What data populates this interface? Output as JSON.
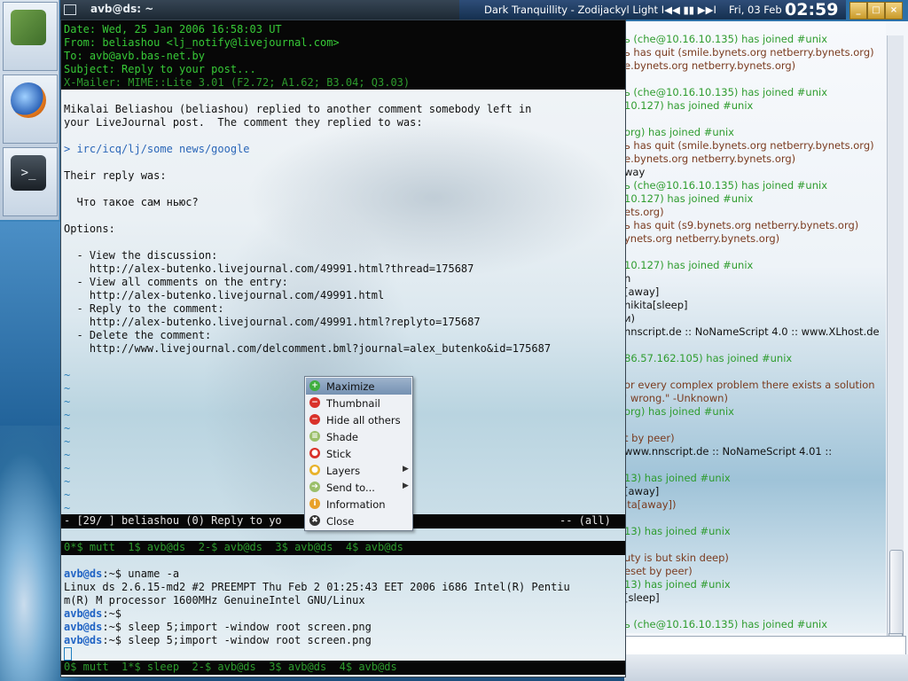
{
  "terminal": {
    "title": "avb@ds: ~",
    "headers": [
      "Date: Wed, 25 Jan 2006 16:58:03 UT",
      "From: beliashou <lj_notify@livejournal.com>",
      "To: avb@avb.bas-net.by",
      "Subject: Reply to your post...",
      "X-Mailer: MIME::Lite 3.01 (F2.72; A1.62; B3.04; Q3.03)"
    ],
    "body": [
      "Mikalai Beliashou (beliashou) replied to another comment somebody left in",
      "your LiveJournal post.  The comment they replied to was:",
      "",
      "> irc/icq/lj/some news/google",
      "",
      "Their reply was:",
      "",
      "  Что такое сам ньюс?",
      "",
      "Options:",
      "",
      "  - View the discussion:",
      "    http://alex-butenko.livejournal.com/49991.html?thread=175687",
      "  - View all comments on the entry:",
      "    http://alex-butenko.livejournal.com/49991.html",
      "  - Reply to the comment:",
      "    http://alex-butenko.livejournal.com/49991.html?replyto=175687",
      "  - Delete the comment:",
      "    http://www.livejournal.com/delcomment.bml?journal=alex_butenko&id=175687"
    ],
    "tildes": [
      "~",
      "~",
      "~",
      "~",
      "~",
      "~",
      "~",
      "~",
      "~",
      "~",
      "~"
    ],
    "status_left": "- [29/ ] beliashou (0) Reply to yo",
    "status_right": "-- (all)",
    "window_list_1": "0*$ mutt  1$ avb@ds  2-$ avb@ds  3$ avb@ds  4$ avb@ds",
    "shell": [
      {
        "prompt": "avb@ds",
        "path": ":~$",
        "cmd": " uname -a"
      },
      {
        "out": "Linux ds 2.6.15-md2 #2 PREEMPT Thu Feb 2 01:25:43 EET 2006 i686 Intel(R) Pentiu"
      },
      {
        "out": "m(R) M processor 1600MHz GenuineIntel GNU/Linux"
      },
      {
        "prompt": "avb@ds",
        "path": ":~$",
        "cmd": ""
      },
      {
        "prompt": "avb@ds",
        "path": ":~$",
        "cmd": " sleep 5;import -window root screen.png"
      },
      {
        "prompt": "avb@ds",
        "path": ":~$",
        "cmd": " sleep 5;import -window root screen.png"
      }
    ],
    "window_list_2": "0$ mutt  1*$ sleep  2-$ avb@ds  3$ avb@ds  4$ avb@ds"
  },
  "panel": {
    "song": "Dark Tranquillity - Zodijackyl Light",
    "player_controls": "I◀◀ ▮▮ ▶▶I",
    "date": "Fri, 03 Feb",
    "time": "02:59",
    "wm_buttons": [
      "_",
      "□",
      "×"
    ]
  },
  "context_menu": {
    "items": [
      {
        "label": "Maximize",
        "icon": "maximize-icon",
        "color": "#3fae3f",
        "glyph": "+",
        "submenu": false
      },
      {
        "label": "Thumbnail",
        "icon": "thumbnail-icon",
        "color": "#d9312a",
        "glyph": "−",
        "submenu": false
      },
      {
        "label": "Hide all others",
        "icon": "hide-others-icon",
        "color": "#d9312a",
        "glyph": "−",
        "submenu": false
      },
      {
        "label": "Shade",
        "icon": "shade-icon",
        "color": "#9bbf6a",
        "glyph": "≡",
        "submenu": false
      },
      {
        "label": "Stick",
        "icon": "stick-icon",
        "color": "#d9312a",
        "glyph": "●",
        "submenu": false
      },
      {
        "label": "Layers",
        "icon": "layers-icon",
        "color": "#e8b22a",
        "glyph": "●",
        "submenu": true
      },
      {
        "label": "Send to...",
        "icon": "send-to-icon",
        "color": "#9bbf6a",
        "glyph": "➔",
        "submenu": true
      },
      {
        "label": "Information",
        "icon": "information-icon",
        "color": "#e8a12a",
        "glyph": "i",
        "submenu": false
      },
      {
        "label": "Close",
        "icon": "close-icon",
        "color": "#333333",
        "glyph": "✖",
        "submenu": false
      }
    ]
  },
  "irc": {
    "lines": [
      {
        "text": "ь (che@10.16.10.135) has joined #unix",
        "cls": "c-green"
      },
      {
        "text": "ь has quit (smile.bynets.org netberry.bynets.org)",
        "cls": "c-brown"
      },
      {
        "text": "e.bynets.org netberry.bynets.org)",
        "cls": "c-brown"
      },
      {
        "text": "",
        "cls": "c-black"
      },
      {
        "text": "ь (che@10.16.10.135) has joined #unix",
        "cls": "c-green"
      },
      {
        "text": "10.127) has joined #unix",
        "cls": "c-green"
      },
      {
        "text": "",
        "cls": "c-black"
      },
      {
        "text": "org) has joined #unix",
        "cls": "c-green"
      },
      {
        "text": "ь has quit (smile.bynets.org netberry.bynets.org)",
        "cls": "c-brown"
      },
      {
        "text": "e.bynets.org netberry.bynets.org)",
        "cls": "c-brown"
      },
      {
        "text": "way",
        "cls": "c-black"
      },
      {
        "text": "ь (che@10.16.10.135) has joined #unix",
        "cls": "c-green"
      },
      {
        "text": "10.127) has joined #unix",
        "cls": "c-green"
      },
      {
        "text": "ets.org)",
        "cls": "c-brown"
      },
      {
        "text": "ь has quit (s9.bynets.org netberry.bynets.org)",
        "cls": "c-brown"
      },
      {
        "text": "ynets.org netberry.bynets.org)",
        "cls": "c-brown"
      },
      {
        "text": "",
        "cls": "c-black"
      },
      {
        "text": "10.127) has joined #unix",
        "cls": "c-green"
      },
      {
        "text": "n",
        "cls": "c-black"
      },
      {
        "text": "[away]",
        "cls": "c-black"
      },
      {
        "text": "nikita[sleep]",
        "cls": "c-black"
      },
      {
        "text": "и)",
        "cls": "c-black"
      },
      {
        "text": "nnscript.de :: NoNameScript 4.0 :: www.XLhost.de",
        "cls": "c-black"
      },
      {
        "text": "",
        "cls": "c-black"
      },
      {
        "text": "86.57.162.105) has joined #unix",
        "cls": "c-green"
      },
      {
        "text": "",
        "cls": "c-black"
      },
      {
        "text": "or every complex problem there exists a solution",
        "cls": "c-brown"
      },
      {
        "text": "' wrong.\"  -Unknown)",
        "cls": "c-brown"
      },
      {
        "text": "org) has joined #unix",
        "cls": "c-green"
      },
      {
        "text": "",
        "cls": "c-black"
      },
      {
        "text": "t by peer)",
        "cls": "c-brown"
      },
      {
        "text": "www.nnscript.de :: NoNameScript 4.01 ::",
        "cls": "c-black"
      },
      {
        "text": "",
        "cls": "c-black"
      },
      {
        "text": "13) has joined #unix",
        "cls": "c-green"
      },
      {
        "text": "[away]",
        "cls": "c-black"
      },
      {
        "text": "ita[away])",
        "cls": "c-brown"
      },
      {
        "text": "",
        "cls": "c-black"
      },
      {
        "text": "13) has joined #unix",
        "cls": "c-green"
      },
      {
        "text": "",
        "cls": "c-black"
      },
      {
        "text": "uty is but skin deep)",
        "cls": "c-brown"
      },
      {
        "text": "eset by peer)",
        "cls": "c-brown"
      },
      {
        "text": "13) has joined #unix",
        "cls": "c-green"
      },
      {
        "text": "[sleep]",
        "cls": "c-black"
      },
      {
        "text": "",
        "cls": "c-black"
      },
      {
        "text": "ь (che@10.16.10.135) has joined #unix",
        "cls": "c-green"
      }
    ]
  }
}
